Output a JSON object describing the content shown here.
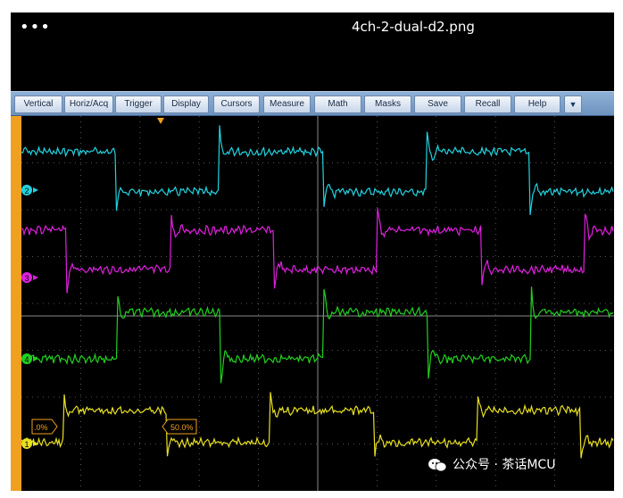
{
  "window": {
    "title": "4ch-2-dual-d2.png",
    "more_label": "•••"
  },
  "menu": [
    {
      "label": "Vertical"
    },
    {
      "label": "Horiz/Acq"
    },
    {
      "label": "Trigger"
    },
    {
      "label": "Display"
    },
    {
      "label": "Cursors"
    },
    {
      "label": "Measure"
    },
    {
      "label": "Math"
    },
    {
      "label": "Masks"
    },
    {
      "label": "Save"
    },
    {
      "label": "Recall"
    },
    {
      "label": "Help"
    }
  ],
  "menu_more": "▼",
  "channels": [
    {
      "label": "2",
      "color": "#22d3e0"
    },
    {
      "label": "3",
      "color": "#e020e0"
    },
    {
      "label": "4",
      "color": "#22d020"
    },
    {
      "label": "1",
      "color": "#e8e020"
    }
  ],
  "trigger_level_labels": [
    ".0%",
    "50.0%"
  ],
  "watermark": "公众号 · 茶话MCU",
  "colors": {
    "menubar": "#7a9dc8",
    "accent": "#f0a020",
    "graticule": "#6f6f6f",
    "background": "#000000"
  },
  "icons": {
    "trigger_marker": "triangle-down",
    "channel_marker": "circle-with-arrow",
    "watermark_icon": "wechat-icon"
  }
}
